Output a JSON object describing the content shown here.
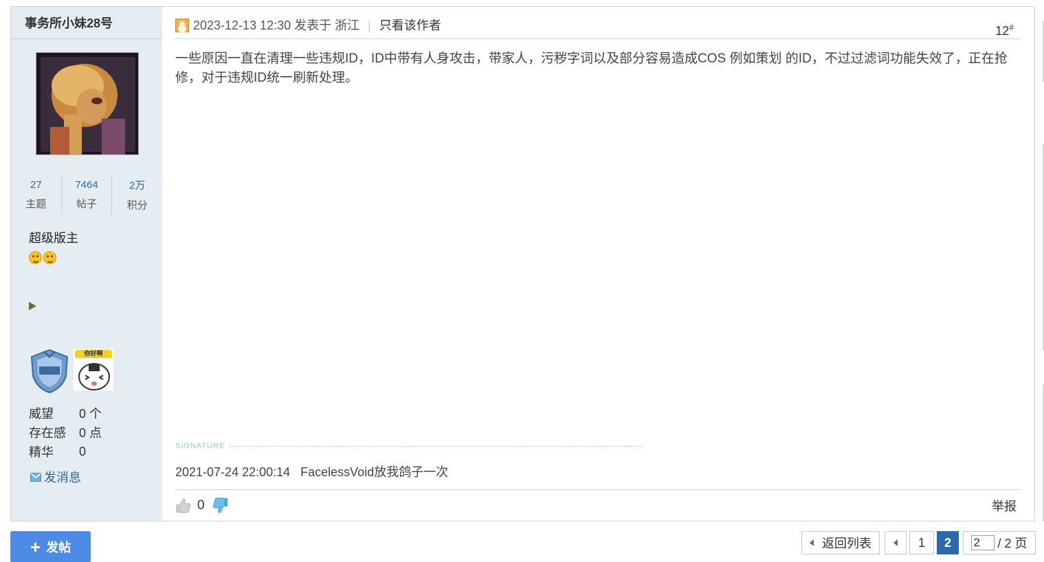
{
  "author": {
    "name": "事务所小妹28号",
    "stats": [
      {
        "value": "27",
        "label": "主题"
      },
      {
        "value": "7464",
        "label": "帖子"
      },
      {
        "value": "2万",
        "label": "积分"
      }
    ],
    "rank": "超级版主",
    "profile": [
      {
        "key": "威望",
        "value": "0 个"
      },
      {
        "key": "存在感",
        "value": "0 点"
      },
      {
        "key": "精华",
        "value": "0"
      }
    ],
    "send_message": "发消息",
    "medal_face_tag": "你好啊"
  },
  "post": {
    "meta": "2023-12-13 12:30 发表于 浙江",
    "author_only": "只看该作者",
    "floor": "12",
    "floor_mark": "#",
    "content": "一些原因一直在清理一些违规ID，ID中带有人身攻击，带家人，污秽字词以及部分容易造成COS 例如策划 的ID，不过过滤词功能失效了，正在抢修，对于违规ID统一刷新处理。",
    "signature_label": "SIGNATURE",
    "signature": "2021-07-24 22:00:14   FacelessVoid放我鸽子一次",
    "like_count": "0",
    "report": "举报"
  },
  "toolbar": {
    "new_post": "发帖"
  },
  "pagination": {
    "back_to_list": "返回列表",
    "pages": [
      "1",
      "2"
    ],
    "current": "2",
    "input_value": "2",
    "total": "/ 2 页"
  },
  "colors": {
    "sidebar_bg": "#e5edf2",
    "border": "#c2d5e3",
    "new_post_button": "#4c8ce6",
    "current_page": "#2b6aa8"
  }
}
